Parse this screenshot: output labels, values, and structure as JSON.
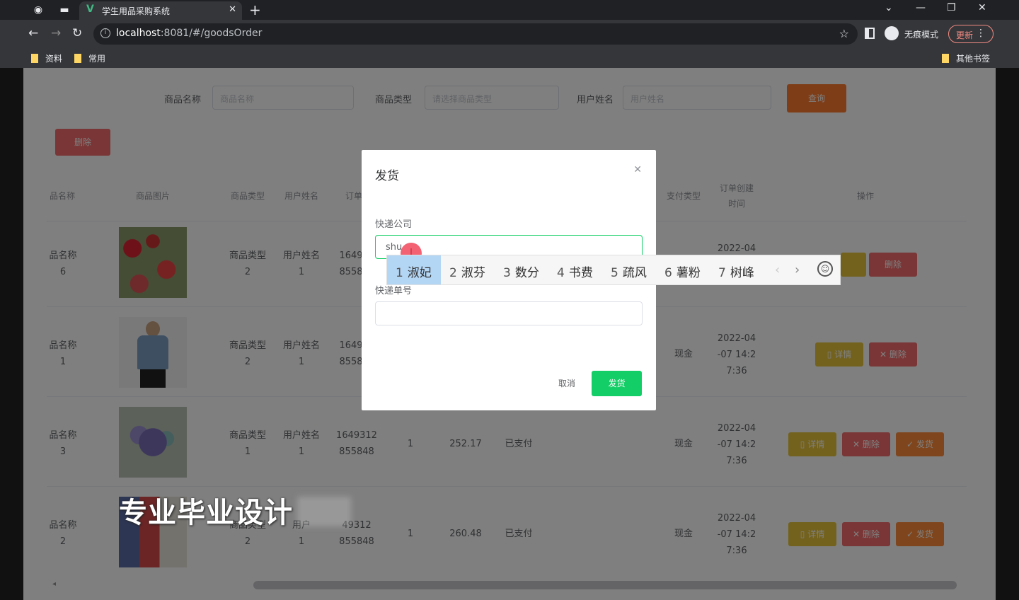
{
  "browser": {
    "tab_title": "学生用品采购系统",
    "url_host": "localhost",
    "url_rest": ":8081/#/goodsOrder",
    "incognito_label": "无痕模式",
    "update_label": "更新",
    "bookmarks": [
      "资料",
      "常用"
    ],
    "other_bookmarks": "其他书签"
  },
  "filters": {
    "goods_name_label": "商品名称",
    "goods_name_placeholder": "商品名称",
    "goods_type_label": "商品类型",
    "goods_type_placeholder": "请选择商品类型",
    "user_name_label": "用户姓名",
    "user_name_placeholder": "用户姓名",
    "search_button": "查询",
    "delete_button": "删除"
  },
  "table": {
    "headers": [
      "品名称",
      "商品图片",
      "商品类型",
      "用户姓名",
      "订单",
      "支付类型",
      "订单创建时间",
      "操作"
    ],
    "rows": [
      {
        "name_l1": "品名称",
        "name_l2": "6",
        "type_l1": "商品类型",
        "type_l2": "2",
        "user_l1": "用户姓名",
        "user_l2": "1",
        "order_l1": "1649",
        "order_l2": "8558",
        "qty": "",
        "price": "",
        "status": "",
        "pay": "",
        "date_l1": "2022-04",
        "date_l2": "",
        "date_l3": "",
        "actions": [
          "",
          "删除"
        ]
      },
      {
        "name_l1": "品名称",
        "name_l2": "1",
        "type_l1": "商品类型",
        "type_l2": "2",
        "user_l1": "用户姓名",
        "user_l2": "1",
        "order_l1": "1649",
        "order_l2": "8558",
        "qty": "",
        "price": "",
        "status": "",
        "pay": "现金",
        "date_l1": "2022-04",
        "date_l2": "-07 14:2",
        "date_l3": "7:36",
        "actions": [
          "详情",
          "删除"
        ]
      },
      {
        "name_l1": "品名称",
        "name_l2": "3",
        "type_l1": "商品类型",
        "type_l2": "1",
        "user_l1": "用户姓名",
        "user_l2": "1",
        "order_l1": "1649312",
        "order_l2": "855848",
        "qty": "1",
        "price": "252.17",
        "status": "已支付",
        "pay": "现金",
        "date_l1": "2022-04",
        "date_l2": "-07 14:2",
        "date_l3": "7:36",
        "actions": [
          "详情",
          "删除",
          "发货"
        ]
      },
      {
        "name_l1": "品名称",
        "name_l2": "2",
        "type_l1": "商品类型",
        "type_l2": "2",
        "user_l1": "用户",
        "user_l2": "1",
        "order_l1": "49312",
        "order_l2": "855848",
        "qty": "1",
        "price": "260.48",
        "status": "已支付",
        "pay": "现金",
        "date_l1": "2022-04",
        "date_l2": "-07 14:2",
        "date_l3": "7:36",
        "actions": [
          "详情",
          "删除",
          "发货"
        ]
      }
    ]
  },
  "dialog": {
    "title": "发货",
    "company_label": "快递公司",
    "company_value": "shu",
    "tracking_label": "快递单号",
    "cancel_button": "取消",
    "confirm_button": "发货"
  },
  "ime": {
    "candidates": [
      {
        "num": "1",
        "text": "淑妃"
      },
      {
        "num": "2",
        "text": "淑芬"
      },
      {
        "num": "3",
        "text": "数分"
      },
      {
        "num": "4",
        "text": "书费"
      },
      {
        "num": "5",
        "text": "疏风"
      },
      {
        "num": "6",
        "text": "薯粉"
      },
      {
        "num": "7",
        "text": "树峰"
      }
    ]
  },
  "watermark": "专业毕业设计",
  "colors": {
    "primary_green": "#13ce66",
    "danger_red": "#f56c6c",
    "warning_yellow": "#e6a23c",
    "highlight_blue": "#b4d6f5"
  }
}
